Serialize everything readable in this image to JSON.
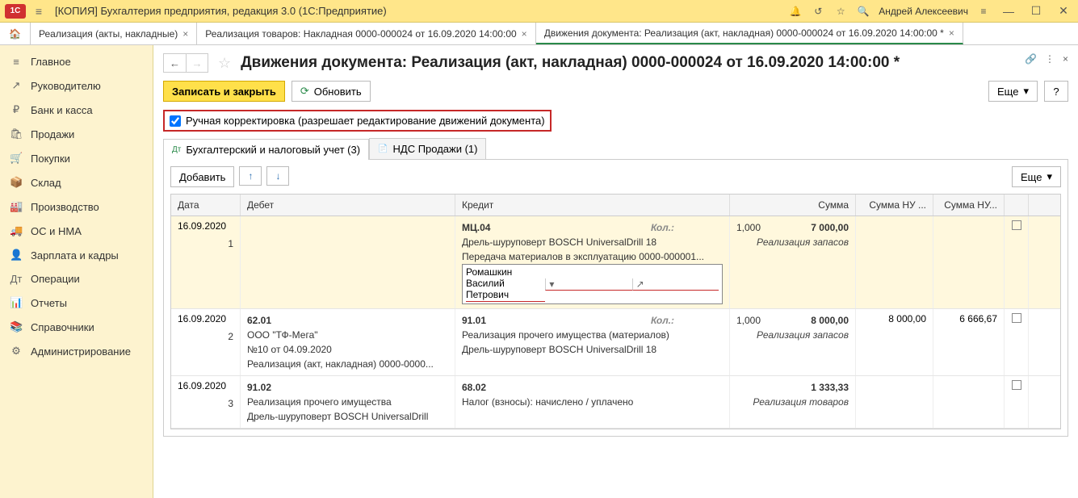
{
  "titlebar": {
    "title": "[КОПИЯ] Бухгалтерия предприятия, редакция 3.0  (1С:Предприятие)",
    "user": "Андрей Алексеевич"
  },
  "tabs": [
    {
      "label": "Реализация (акты, накладные)"
    },
    {
      "label": "Реализация товаров: Накладная 0000-000024 от 16.09.2020 14:00:00"
    },
    {
      "label": "Движения документа: Реализация (акт, накладная) 0000-000024 от 16.09.2020 14:00:00 *"
    }
  ],
  "sidebar": [
    {
      "icon": "≡",
      "label": "Главное"
    },
    {
      "icon": "↗",
      "label": "Руководителю"
    },
    {
      "icon": "₽",
      "label": "Банк и касса"
    },
    {
      "icon": "🛍",
      "label": "Продажи"
    },
    {
      "icon": "🛒",
      "label": "Покупки"
    },
    {
      "icon": "📦",
      "label": "Склад"
    },
    {
      "icon": "🏭",
      "label": "Производство"
    },
    {
      "icon": "🚚",
      "label": "ОС и НМА"
    },
    {
      "icon": "👤",
      "label": "Зарплата и кадры"
    },
    {
      "icon": "Дт",
      "label": "Операции"
    },
    {
      "icon": "📊",
      "label": "Отчеты"
    },
    {
      "icon": "📚",
      "label": "Справочники"
    },
    {
      "icon": "⚙",
      "label": "Администрирование"
    }
  ],
  "document": {
    "title": "Движения документа: Реализация (акт, накладная) 0000-000024 от 16.09.2020 14:00:00 *",
    "btn_save_close": "Записать и закрыть",
    "btn_refresh": "Обновить",
    "btn_more": "Еще",
    "checkbox_label": "Ручная корректировка (разрешает редактирование движений документа)"
  },
  "subtabs": [
    {
      "label": "Бухгалтерский и налоговый учет (3)"
    },
    {
      "label": "НДС Продажи (1)"
    }
  ],
  "grid_toolbar": {
    "add": "Добавить",
    "more": "Еще"
  },
  "grid_headers": {
    "date": "Дата",
    "debit": "Дебет",
    "credit": "Кредит",
    "sum": "Сумма",
    "nu1": "Сумма НУ ...",
    "nu2": "Сумма НУ..."
  },
  "rows": [
    {
      "date": "16.09.2020",
      "num": "1",
      "hl": true,
      "debit": [],
      "credit_main": "МЦ.04",
      "credit_qty_lbl": "Кол.:",
      "credit_qty": "1,000",
      "credit_lines": [
        "Дрель-шуруповерт BOSCH UniversalDrill 18",
        "Передача материалов в эксплуатацию 0000-000001..."
      ],
      "credit_input": "Ромашкин Василий Петрович",
      "sum": "7 000,00",
      "sum_note": "Реализация запасов",
      "nu1": "",
      "nu2": ""
    },
    {
      "date": "16.09.2020",
      "num": "2",
      "debit_main": "62.01",
      "debit_lines": [
        "ООО \"ТФ-Мега\"",
        "№10 от 04.09.2020",
        "Реализация (акт, накладная) 0000-0000..."
      ],
      "credit_main": "91.01",
      "credit_qty_lbl": "Кол.:",
      "credit_qty": "1,000",
      "credit_lines": [
        "Реализация прочего имущества (материалов)",
        "Дрель-шуруповерт BOSCH UniversalDrill 18"
      ],
      "sum": "8 000,00",
      "sum_note": "Реализация запасов",
      "nu1": "8 000,00",
      "nu2": "6 666,67"
    },
    {
      "date": "16.09.2020",
      "num": "3",
      "debit_main": "91.02",
      "debit_lines": [
        "Реализация прочего имущества",
        "Дрель-шуруповерт BOSCH UniversalDrill"
      ],
      "credit_main": "68.02",
      "credit_lines": [
        "Налог (взносы): начислено / уплачено"
      ],
      "sum": "1 333,33",
      "sum_note": "Реализация товаров",
      "nu1": "",
      "nu2": ""
    }
  ]
}
